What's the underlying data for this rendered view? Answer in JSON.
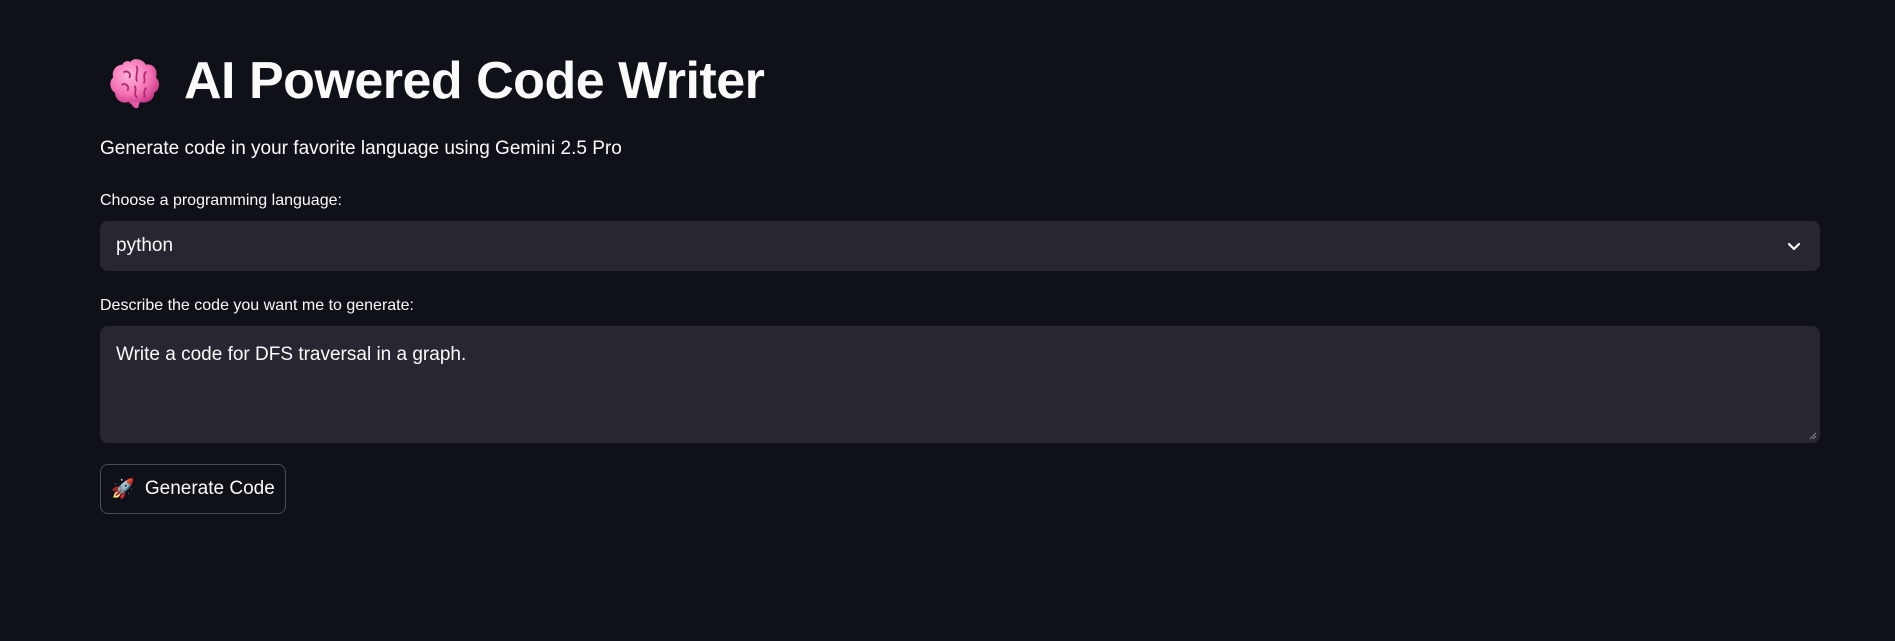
{
  "header": {
    "title": "AI Powered Code Writer",
    "title_icon": "brain-icon",
    "subtitle": "Generate code in your favorite language using Gemini 2.5 Pro"
  },
  "form": {
    "language_label": "Choose a programming language:",
    "language_value": "python",
    "description_label": "Describe the code you want me to generate:",
    "description_value": "Write a code for DFS traversal in a graph.",
    "generate_button": {
      "icon": "rocket-icon",
      "icon_glyph": "🚀",
      "label": "Generate Code"
    }
  },
  "colors": {
    "background": "#0e1117",
    "input_background": "#262730",
    "text": "#fafafa",
    "button_border": "#4a4c56",
    "brain_pink": "#f472b6"
  }
}
